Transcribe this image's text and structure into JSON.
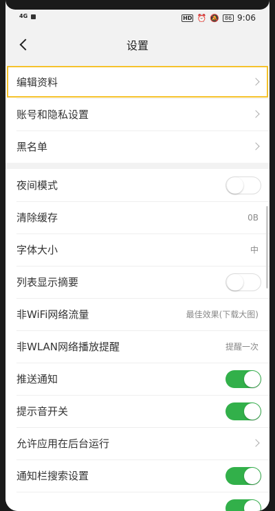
{
  "status": {
    "signal": "4G",
    "hd": "HD",
    "battery": "86",
    "time": "9:06"
  },
  "header": {
    "title": "设置"
  },
  "colors": {
    "toggle_on": "#32b04a",
    "highlight": "#f5c12a"
  },
  "group1": [
    {
      "label": "编辑资料"
    },
    {
      "label": "账号和隐私设置"
    },
    {
      "label": "黑名单"
    }
  ],
  "group2": [
    {
      "label": "夜间模式",
      "toggle": "off"
    },
    {
      "label": "清除缓存",
      "value": "0B"
    },
    {
      "label": "字体大小",
      "value": "中"
    },
    {
      "label": "列表显示摘要",
      "toggle": "off"
    },
    {
      "label": "非WiFi网络流量",
      "value": "最佳效果(下载大图)"
    },
    {
      "label": "非WLAN网络播放提醒",
      "value": "提醒一次"
    },
    {
      "label": "推送通知",
      "toggle": "on"
    },
    {
      "label": "提示音开关",
      "toggle": "on"
    },
    {
      "label": "允许应用在后台运行"
    },
    {
      "label": "通知栏搜索设置",
      "toggle": "on"
    }
  ]
}
